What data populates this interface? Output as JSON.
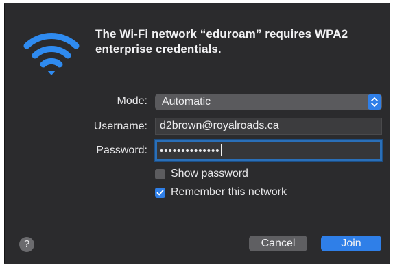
{
  "dialog": {
    "title": "The Wi-Fi network “eduroam” requires WPA2 enterprise credentials.",
    "icon": "wifi-icon",
    "accent_color": "#2f7fe8",
    "background_color": "#2b2b2d"
  },
  "form": {
    "mode_label": "Mode:",
    "mode_value": "Automatic",
    "username_label": "Username:",
    "username_value": "d2brown@royalroads.ca",
    "password_label": "Password:",
    "password_masked": "••••••••••••••",
    "show_password_label": "Show password",
    "show_password_checked": false,
    "remember_label": "Remember this network",
    "remember_checked": true
  },
  "buttons": {
    "help_label": "?",
    "cancel_label": "Cancel",
    "join_label": "Join"
  }
}
